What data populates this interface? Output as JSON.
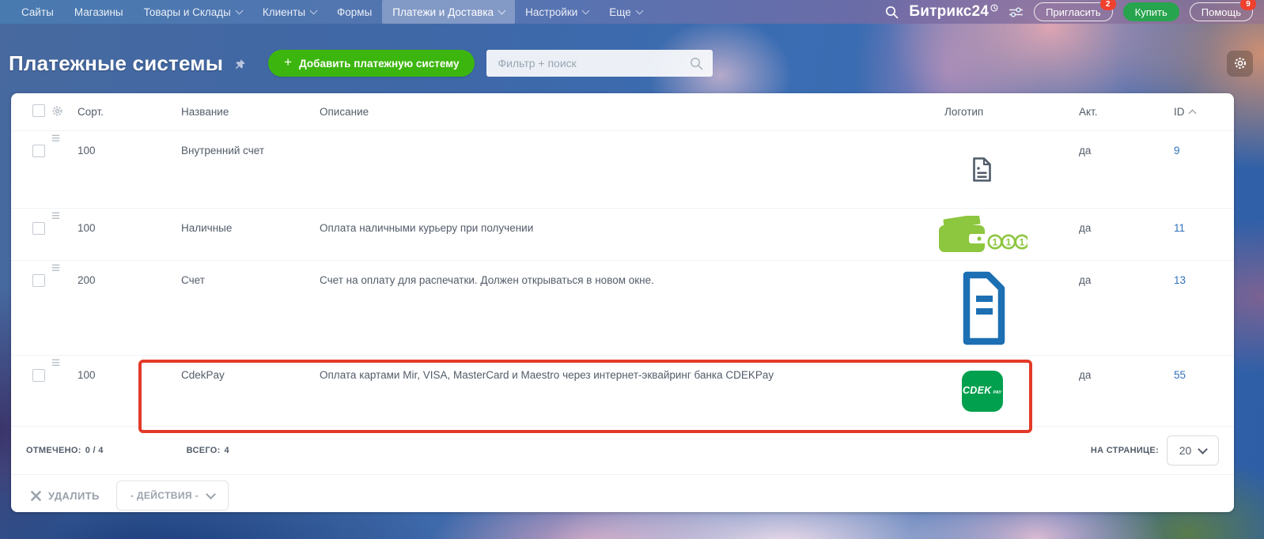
{
  "topnav": {
    "items": [
      {
        "label": "Сайты",
        "dropdown": false,
        "active": false
      },
      {
        "label": "Магазины",
        "dropdown": false,
        "active": false
      },
      {
        "label": "Товары и Склады",
        "dropdown": true,
        "active": false
      },
      {
        "label": "Клиенты",
        "dropdown": true,
        "active": false
      },
      {
        "label": "Формы",
        "dropdown": false,
        "active": false
      },
      {
        "label": "Платежи и Доставка",
        "dropdown": true,
        "active": true
      },
      {
        "label": "Настройки",
        "dropdown": true,
        "active": false
      },
      {
        "label": "Еще",
        "dropdown": true,
        "active": false
      }
    ],
    "brand": "Битрикс24",
    "invite_label": "Пригласить",
    "invite_badge": "2",
    "buy_label": "Купить",
    "help_label": "Помощь",
    "help_badge": "9"
  },
  "header": {
    "title": "Платежные системы",
    "add_button_plus": "+",
    "add_button": "Добавить платежную систему",
    "search_placeholder": "Фильтр + поиск"
  },
  "table": {
    "columns": {
      "sort": "Сорт.",
      "name": "Название",
      "description": "Описание",
      "logo": "Логотип",
      "active": "Акт.",
      "id": "ID"
    },
    "sort_order": "ascending",
    "rows": [
      {
        "sort": "100",
        "name": "Внутренний счет",
        "description": "",
        "logo": "document-small",
        "active": "да",
        "id": "9",
        "highlighted": false
      },
      {
        "sort": "100",
        "name": "Наличные",
        "description": "Оплата наличными курьеру при получении",
        "logo": "wallet-coins",
        "active": "да",
        "id": "11",
        "highlighted": false
      },
      {
        "sort": "200",
        "name": "Счет",
        "description": "Счет на оплату для распечатки. Должен открываться в новом окне.",
        "logo": "document-large",
        "active": "да",
        "id": "13",
        "highlighted": false
      },
      {
        "sort": "100",
        "name": "CdekPay",
        "description": "Оплата картами Mir, VISA, MasterCard и Maestro через интернет-эквайринг банка CDEKPay",
        "logo": "cdek-pay",
        "active": "да",
        "id": "55",
        "highlighted": true
      }
    ]
  },
  "logos": {
    "cdek_text": "CDEK",
    "cdek_sub": "PAY"
  },
  "footer": {
    "checked_label": "ОТМЕЧЕНО:",
    "checked_value": "0 / 4",
    "total_label": "ВСЕГО:",
    "total_value": "4",
    "per_page_label": "НА СТРАНИЦЕ:",
    "per_page_value": "20"
  },
  "actions": {
    "delete_label": "УДАЛИТЬ",
    "actions_label": "- ДЕЙСТВИЯ -"
  },
  "colors": {
    "accent_green": "#3cb60e",
    "buy_green": "#27a44e",
    "badge_red": "#f0402e",
    "cdek_green": "#00a04e",
    "wallet_green": "#8dc63f",
    "doc_blue": "#1c6fb2",
    "doc_gray": "#4f5b68",
    "link_blue": "#2f72b9",
    "highlight_red": "#e23a28"
  }
}
